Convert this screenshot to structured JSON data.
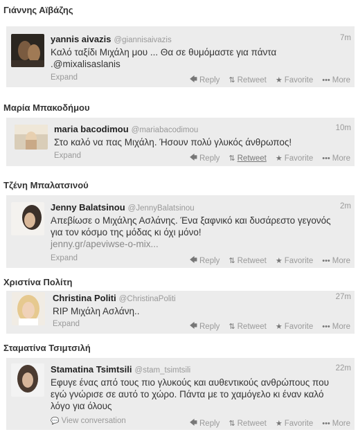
{
  "sections": [
    {
      "name": "Γιάννης Αϊβάζης",
      "fullname": "yannis aivazis",
      "handle": "@giannisaivazis",
      "time": "7m",
      "text_lines": [
        "Καλό ταξίδι Μιχάλη μου ... Θα σε θυμόμαστε για πάντα",
        ".@mixalisaslanis"
      ],
      "expand": "Expand"
    },
    {
      "name": "Μαρία Μπακοδήμου",
      "fullname": "maria bacodimou",
      "handle": "@mariabacodimou",
      "time": "10m",
      "text_lines": [
        "Στο καλό να πας Μιχάλη. Ήσουν πολύ γλυκός άνθρωπος!"
      ],
      "expand": "Expand"
    },
    {
      "name": "Τζένη Μπαλατσινού",
      "fullname": "Jenny Balatsinou",
      "handle": "@JennyBalatsinou",
      "time": "2m",
      "text_lines": [
        "Απεβίωσε ο Μιχάλης Ασλάνης. Ένα ξαφνικό και δυσάρεστο γεγονός",
        "για τον κόσμο της μόδας κι όχι μόνο!"
      ],
      "link": "jenny.gr/apeviwse-o-mix...",
      "expand": "Expand"
    },
    {
      "name": "Χριστίνα Πολίτη",
      "fullname": "Christina Politi",
      "handle": "@ChristinaPoliti",
      "time": "27m",
      "text_lines": [
        "RIP Μιχάλη Ασλάνη.."
      ],
      "expand": "Expand"
    },
    {
      "name": "Σταματίνα Τσιμτσιλή",
      "fullname": "Stamatina Tsimtsili",
      "handle": "@stam_tsimtsili",
      "time": "22m",
      "text_lines": [
        "Εφυγε ένας από τους πιο γλυκούς και αυθεντικούς ανθρώπους που",
        "εγώ γνώρισε σε αυτό το χώρο. Πάντα με το χαμόγελο κι έναν καλό",
        "λόγο για όλους"
      ],
      "expand": "View conversation"
    }
  ],
  "actions": {
    "reply": "Reply",
    "retweet": "Retweet",
    "favorite": "Favorite",
    "more": "More"
  },
  "icons": {
    "reply": "reply-arrow-icon",
    "retweet": "retweet-icon",
    "favorite": "star-icon",
    "more": "ellipsis-icon",
    "conversation": "speech-bubble-icon"
  },
  "colors": {
    "card_bg": "#ececec",
    "muted": "#999999",
    "name": "#222222"
  }
}
